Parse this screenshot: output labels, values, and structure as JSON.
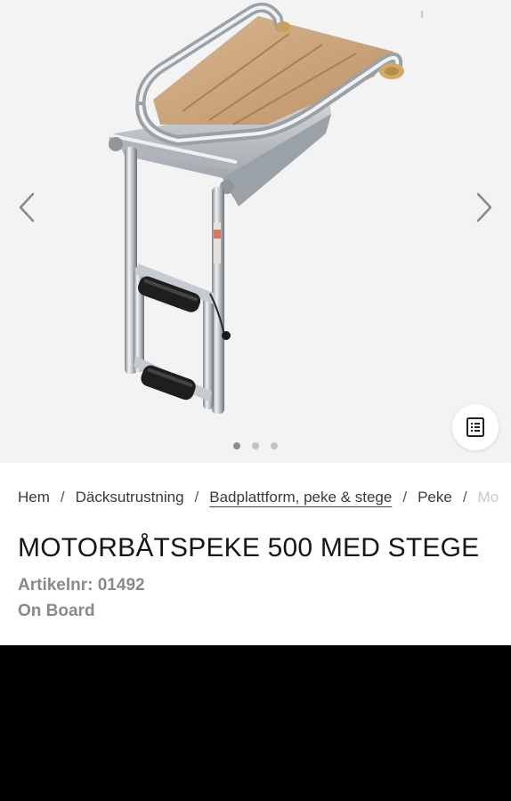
{
  "gallery": {
    "slides_count": 3,
    "active_slide": 1,
    "prev_icon": "chevron-left-icon",
    "next_icon": "chevron-right-icon",
    "list_icon": "list-icon"
  },
  "breadcrumb": [
    {
      "label": "Hem"
    },
    {
      "label": "Däcksutrustning"
    },
    {
      "label": "Badplattform, peke & stege"
    },
    {
      "label": "Peke"
    },
    {
      "label": "Mo"
    }
  ],
  "breadcrumb_separator": "/",
  "product": {
    "title": "MOTORBÅTSPEKE 500 MED STEGE",
    "sku": "Artikelnr: 01492",
    "brand": "On Board"
  },
  "colors": {
    "gallery_bg": "#f3f3f3",
    "teak": "#c9a27a",
    "steel": "#c8ccd0",
    "step": "#1e1e1e"
  }
}
